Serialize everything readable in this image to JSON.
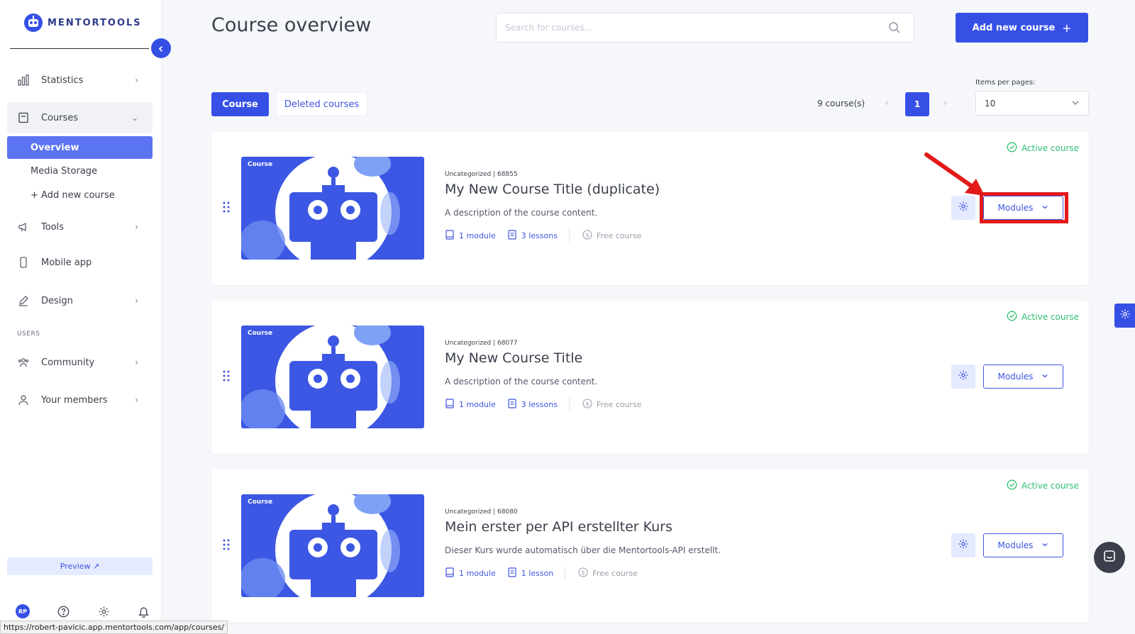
{
  "brand": {
    "name": "MENTORTOOLS"
  },
  "sidebar": {
    "items": [
      {
        "label": "Statistics",
        "icon": "bar-chart-icon"
      },
      {
        "label": "Courses",
        "icon": "book-icon"
      },
      {
        "label": "Tools",
        "icon": "megaphone-icon"
      },
      {
        "label": "Mobile app",
        "icon": "mobile-icon"
      },
      {
        "label": "Design",
        "icon": "pencil-icon"
      },
      {
        "label": "Community",
        "icon": "people-icon"
      },
      {
        "label": "Your members",
        "icon": "user-icon"
      }
    ],
    "courses_sub": [
      "Overview",
      "Media Storage",
      "+ Add new course"
    ],
    "section_users": "USERS",
    "preview_label": "Preview ↗",
    "avatar_initials": "RP"
  },
  "header": {
    "title": "Course overview",
    "search_placeholder": "Search for courses...",
    "add_button": "Add new course"
  },
  "tabs": {
    "course": "Course",
    "deleted": "Deleted courses"
  },
  "pagination": {
    "count": "9 course(s)",
    "prev": "‹",
    "current": "1",
    "next": "›",
    "items_per_page_label": "Items per pages:",
    "items_per_page_value": "10"
  },
  "courses": [
    {
      "thumb_label": "Course",
      "meta": "Uncategorized | 68855",
      "title": "My New Course Title (duplicate)",
      "description": "A description of the course content.",
      "modules": "1 module",
      "lessons": "3 lessons",
      "price": "Free course",
      "status": "Active course",
      "modules_button": "Modules"
    },
    {
      "thumb_label": "Course",
      "meta": "Uncategorized | 68077",
      "title": "My New Course Title",
      "description": "A description of the course content.",
      "modules": "1 module",
      "lessons": "3 lessons",
      "price": "Free course",
      "status": "Active course",
      "modules_button": "Modules"
    },
    {
      "thumb_label": "Course",
      "meta": "Uncategorized | 68080",
      "title": "Mein erster per API erstellter Kurs",
      "description": "Dieser Kurs wurde automatisch über die Mentortools-API erstellt.",
      "modules": "1 module",
      "lessons": "1 lesson",
      "price": "Free course",
      "status": "Active course",
      "modules_button": "Modules"
    }
  ],
  "status_url": "https://robert-pavicic.app.mentortools.com/app/courses/",
  "colors": {
    "accent": "#3650e6",
    "active": "#2fbf71",
    "highlight": "#e41a1a"
  }
}
